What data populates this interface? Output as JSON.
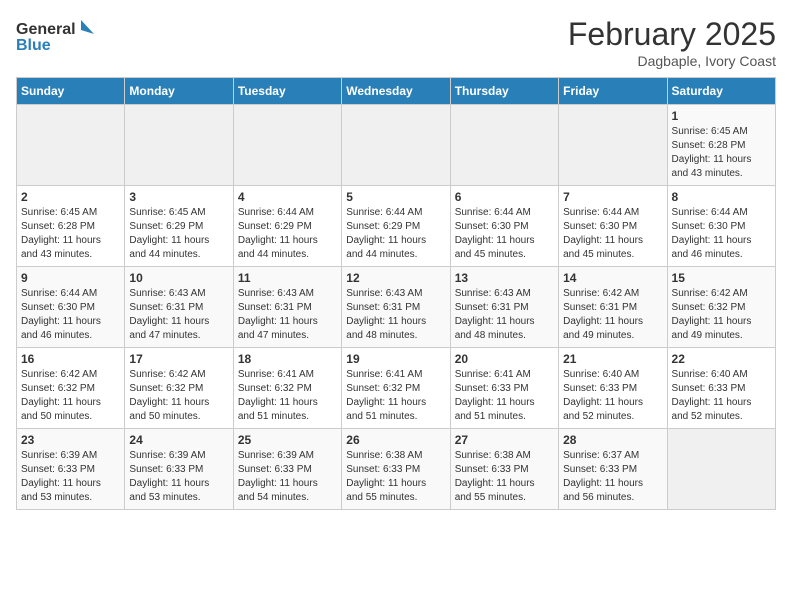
{
  "header": {
    "logo_general": "General",
    "logo_blue": "Blue",
    "title": "February 2025",
    "location": "Dagbaple, Ivory Coast"
  },
  "days_of_week": [
    "Sunday",
    "Monday",
    "Tuesday",
    "Wednesday",
    "Thursday",
    "Friday",
    "Saturday"
  ],
  "weeks": [
    [
      {
        "day": "",
        "info": ""
      },
      {
        "day": "",
        "info": ""
      },
      {
        "day": "",
        "info": ""
      },
      {
        "day": "",
        "info": ""
      },
      {
        "day": "",
        "info": ""
      },
      {
        "day": "",
        "info": ""
      },
      {
        "day": "1",
        "info": "Sunrise: 6:45 AM\nSunset: 6:28 PM\nDaylight: 11 hours\nand 43 minutes."
      }
    ],
    [
      {
        "day": "2",
        "info": "Sunrise: 6:45 AM\nSunset: 6:28 PM\nDaylight: 11 hours\nand 43 minutes."
      },
      {
        "day": "3",
        "info": "Sunrise: 6:45 AM\nSunset: 6:29 PM\nDaylight: 11 hours\nand 44 minutes."
      },
      {
        "day": "4",
        "info": "Sunrise: 6:44 AM\nSunset: 6:29 PM\nDaylight: 11 hours\nand 44 minutes."
      },
      {
        "day": "5",
        "info": "Sunrise: 6:44 AM\nSunset: 6:29 PM\nDaylight: 11 hours\nand 44 minutes."
      },
      {
        "day": "6",
        "info": "Sunrise: 6:44 AM\nSunset: 6:30 PM\nDaylight: 11 hours\nand 45 minutes."
      },
      {
        "day": "7",
        "info": "Sunrise: 6:44 AM\nSunset: 6:30 PM\nDaylight: 11 hours\nand 45 minutes."
      },
      {
        "day": "8",
        "info": "Sunrise: 6:44 AM\nSunset: 6:30 PM\nDaylight: 11 hours\nand 46 minutes."
      }
    ],
    [
      {
        "day": "9",
        "info": "Sunrise: 6:44 AM\nSunset: 6:30 PM\nDaylight: 11 hours\nand 46 minutes."
      },
      {
        "day": "10",
        "info": "Sunrise: 6:43 AM\nSunset: 6:31 PM\nDaylight: 11 hours\nand 47 minutes."
      },
      {
        "day": "11",
        "info": "Sunrise: 6:43 AM\nSunset: 6:31 PM\nDaylight: 11 hours\nand 47 minutes."
      },
      {
        "day": "12",
        "info": "Sunrise: 6:43 AM\nSunset: 6:31 PM\nDaylight: 11 hours\nand 48 minutes."
      },
      {
        "day": "13",
        "info": "Sunrise: 6:43 AM\nSunset: 6:31 PM\nDaylight: 11 hours\nand 48 minutes."
      },
      {
        "day": "14",
        "info": "Sunrise: 6:42 AM\nSunset: 6:31 PM\nDaylight: 11 hours\nand 49 minutes."
      },
      {
        "day": "15",
        "info": "Sunrise: 6:42 AM\nSunset: 6:32 PM\nDaylight: 11 hours\nand 49 minutes."
      }
    ],
    [
      {
        "day": "16",
        "info": "Sunrise: 6:42 AM\nSunset: 6:32 PM\nDaylight: 11 hours\nand 50 minutes."
      },
      {
        "day": "17",
        "info": "Sunrise: 6:42 AM\nSunset: 6:32 PM\nDaylight: 11 hours\nand 50 minutes."
      },
      {
        "day": "18",
        "info": "Sunrise: 6:41 AM\nSunset: 6:32 PM\nDaylight: 11 hours\nand 51 minutes."
      },
      {
        "day": "19",
        "info": "Sunrise: 6:41 AM\nSunset: 6:32 PM\nDaylight: 11 hours\nand 51 minutes."
      },
      {
        "day": "20",
        "info": "Sunrise: 6:41 AM\nSunset: 6:33 PM\nDaylight: 11 hours\nand 51 minutes."
      },
      {
        "day": "21",
        "info": "Sunrise: 6:40 AM\nSunset: 6:33 PM\nDaylight: 11 hours\nand 52 minutes."
      },
      {
        "day": "22",
        "info": "Sunrise: 6:40 AM\nSunset: 6:33 PM\nDaylight: 11 hours\nand 52 minutes."
      }
    ],
    [
      {
        "day": "23",
        "info": "Sunrise: 6:39 AM\nSunset: 6:33 PM\nDaylight: 11 hours\nand 53 minutes."
      },
      {
        "day": "24",
        "info": "Sunrise: 6:39 AM\nSunset: 6:33 PM\nDaylight: 11 hours\nand 53 minutes."
      },
      {
        "day": "25",
        "info": "Sunrise: 6:39 AM\nSunset: 6:33 PM\nDaylight: 11 hours\nand 54 minutes."
      },
      {
        "day": "26",
        "info": "Sunrise: 6:38 AM\nSunset: 6:33 PM\nDaylight: 11 hours\nand 55 minutes."
      },
      {
        "day": "27",
        "info": "Sunrise: 6:38 AM\nSunset: 6:33 PM\nDaylight: 11 hours\nand 55 minutes."
      },
      {
        "day": "28",
        "info": "Sunrise: 6:37 AM\nSunset: 6:33 PM\nDaylight: 11 hours\nand 56 minutes."
      },
      {
        "day": "",
        "info": ""
      }
    ]
  ]
}
